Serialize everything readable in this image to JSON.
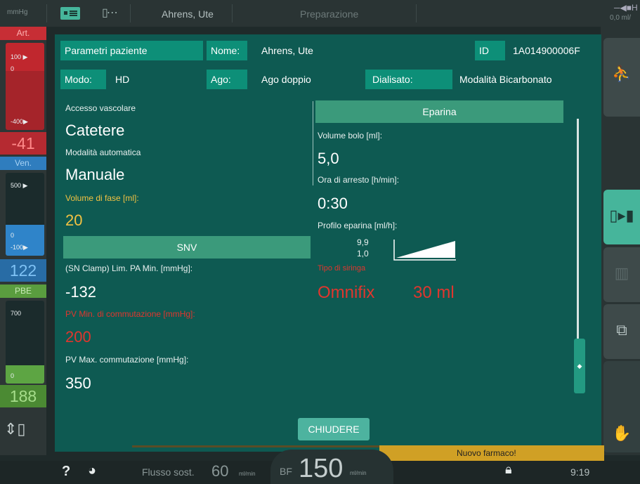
{
  "topbar": {
    "unit": "mmHg",
    "patient_name": "Ahrens, Ute",
    "phase": "Preparazione",
    "right_value": "0,0  ml/"
  },
  "left": {
    "art": {
      "label": "Art.",
      "tick_top": "100 ▶",
      "tick_zero": "0",
      "tick_bottom": "-400▶",
      "value": "-41"
    },
    "ven": {
      "label": "Ven.",
      "tick_top": "500 ▶",
      "tick_zero": "0",
      "tick_bottom": "-100▶",
      "value": "122"
    },
    "pbe": {
      "label": "PBE",
      "tick_top": "700",
      "tick_zero": "0",
      "value": "188"
    }
  },
  "patient": {
    "params_label": "Parametri paziente",
    "name_label": "Nome:",
    "name_value": "Ahrens, Ute",
    "id_label": "ID",
    "id_value": "1A014900006F",
    "mode_label": "Modo:",
    "mode_value": "HD",
    "needle_label": "Ago:",
    "needle_value": "Ago doppio",
    "dialysate_label": "Dialisato:",
    "dialysate_value": "Modalità Bicarbonato"
  },
  "left_panel": {
    "vascular_access_label": "Accesso vascolare",
    "vascular_access_value": "Catetere",
    "auto_mode_label": "Modalità automatica",
    "auto_mode_value": "Manuale",
    "phase_volume_label": "Volume di fase [ml]:",
    "phase_volume_value": "20",
    "snv_header": "SNV",
    "pa_min_label": "(SN Clamp) Lim. PA Min. [mmHg]:",
    "pa_min_value": "-132",
    "pv_min_label": "PV Min. di commutazione [mmHg]:",
    "pv_min_value": "200",
    "pv_max_label": "PV Max. commutazione [mmHg]:",
    "pv_max_value": "350"
  },
  "heparin": {
    "header": "Eparina",
    "bolus_label": "Volume bolo [ml]:",
    "bolus_value": "5,0",
    "stop_label": "Ora di arresto [h/min]:",
    "stop_value": "0:30",
    "profile_label": "Profilo eparina [ml/h]:",
    "profile_max": "9,9",
    "profile_min": "1,0",
    "syringe_label": "Tipo di siringa",
    "syringe_brand": "Omnifix",
    "syringe_size": "30 ml"
  },
  "buttons": {
    "close": "CHIUDERE"
  },
  "alert": {
    "text": "Nuovo farmaco!"
  },
  "bottombar": {
    "help": "?",
    "subst_label": "Flusso sost.",
    "subst_value": "60",
    "subst_unit": "ml/min",
    "bf_label": "BF",
    "bf_value": "150",
    "bf_unit": "ml/min",
    "time": "9:19"
  },
  "colors": {
    "dialog_bg": "#0e5a52",
    "field_green": "#0d8f78",
    "section_green": "#3b9a7b",
    "warn_yellow": "#f2c242",
    "alarm_red": "#e0362e"
  }
}
